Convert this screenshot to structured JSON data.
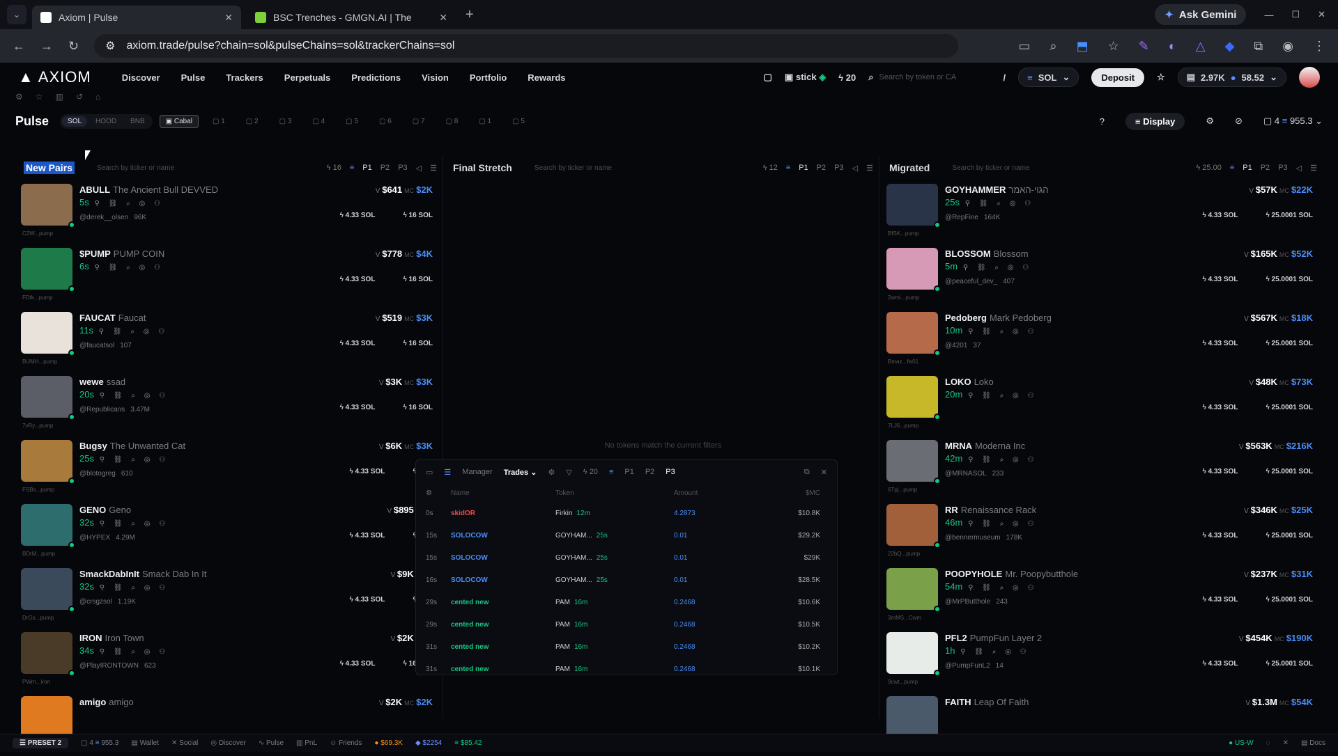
{
  "browser": {
    "tabs": [
      {
        "title": "Axiom | Pulse"
      },
      {
        "title": "BSC Trenches - GMGN.AI | The"
      }
    ],
    "ask_gemini": "Ask Gemini",
    "url": "axiom.trade/pulse?chain=sol&pulseChains=sol&trackerChains=sol"
  },
  "nav": {
    "logo": "AXIOM",
    "items": [
      "Discover",
      "Pulse",
      "Trackers",
      "Perpetuals",
      "Predictions",
      "Vision",
      "Portfolio",
      "Rewards"
    ],
    "wallet_label": "stick",
    "points": "20",
    "search_placeholder": "Search by token or CA",
    "search_key": "/",
    "chain": "SOL",
    "deposit": "Deposit",
    "balance1": "2.97K",
    "balance2": "58.52"
  },
  "pulse": {
    "title": "Pulse",
    "chains": [
      "SOL",
      "HOOD",
      "BNB"
    ],
    "cabal": "Cabal",
    "slots": [
      "1",
      "2",
      "3",
      "4",
      "5",
      "6",
      "7",
      "8",
      "1",
      "5"
    ],
    "display": "Display",
    "count": "4",
    "value": "955.3"
  },
  "columns": [
    {
      "name": "New Pairs",
      "search": "Search by ticker or name",
      "count": "16",
      "presets": [
        "P1",
        "P2",
        "P3"
      ],
      "rows": [
        {
          "sym": "ABULL",
          "name": "The Ancient Bull DEVVED",
          "age": "5s",
          "handle": "@derek__olsen",
          "followers": "96K",
          "caption": "C2W...pump",
          "v": "$641",
          "mc": "$2K",
          "buy1": "4.33 SOL",
          "buy2": "16 SOL",
          "thumb": "#8b6d4e"
        },
        {
          "sym": "$PUMP",
          "name": "PUMP COIN",
          "age": "6s",
          "handle": "",
          "followers": "",
          "caption": "FDtk...pump",
          "v": "$778",
          "mc": "$4K",
          "buy1": "4.33 SOL",
          "buy2": "16 SOL",
          "thumb": "#1f7a4a"
        },
        {
          "sym": "FAUCAT",
          "name": "Faucat",
          "age": "11s",
          "handle": "@faucatsol",
          "followers": "107",
          "caption": "BUMH...pump",
          "v": "$519",
          "mc": "$3K",
          "buy1": "4.33 SOL",
          "buy2": "16 SOL",
          "thumb": "#e8e2da"
        },
        {
          "sym": "wewe",
          "name": "ssad",
          "age": "20s",
          "handle": "@Republicans",
          "followers": "3.47M",
          "caption": "7vRy...pump",
          "v": "$3K",
          "mc": "$3K",
          "buy1": "4.33 SOL",
          "buy2": "16 SOL",
          "thumb": "#5b5e66"
        },
        {
          "sym": "Bugsy",
          "name": "The Unwanted Cat",
          "age": "25s",
          "handle": "@blotogreg",
          "followers": "610",
          "caption": "FSBs...pump",
          "v": "$6K",
          "mc": "$3K",
          "buy1": "4.33 SOL",
          "buy2": "16 S",
          "thumb": "#a87a3c"
        },
        {
          "sym": "GENO",
          "name": "Geno",
          "age": "32s",
          "handle": "@HYPEX",
          "followers": "4.29M",
          "caption": "BDrM...pump",
          "v": "$895",
          "mc": "$",
          "buy1": "4.33 SOL",
          "buy2": "16 S",
          "thumb": "#2d6d6d"
        },
        {
          "sym": "SmackDabInIt",
          "name": "Smack Dab In It",
          "age": "32s",
          "handle": "@crsgzsol",
          "followers": "1.19K",
          "caption": "DrGs...pump",
          "v": "$9K",
          "mc": "$",
          "buy1": "4.33 SOL",
          "buy2": "16 S",
          "thumb": "#3b4a5a"
        },
        {
          "sym": "IRON",
          "name": "Iron Town",
          "age": "34s",
          "handle": "@PlayIRONTOWN",
          "followers": "623",
          "caption": "PWrn...iron",
          "v": "$2K",
          "mc": "$",
          "buy1": "4.33 SOL",
          "buy2": "16 SOL",
          "thumb": "#4a3a28"
        },
        {
          "sym": "amigo",
          "name": "amigo",
          "age": "",
          "handle": "",
          "followers": "",
          "caption": "",
          "v": "$2K",
          "mc": "$2K",
          "buy1": "",
          "buy2": "",
          "thumb": "#e07a20"
        }
      ]
    },
    {
      "name": "Final Stretch",
      "search": "Search by ticker or name",
      "count": "12",
      "presets": [
        "P1",
        "P2",
        "P3"
      ],
      "empty": "No tokens match the current filters"
    },
    {
      "name": "Migrated",
      "search": "Search by ticker or name",
      "count": "25.00",
      "presets": [
        "P1",
        "P2",
        "P3"
      ],
      "rows": [
        {
          "sym": "GOYHAMMER",
          "name": "הגוי-האמר",
          "age": "25s",
          "handle": "@RepFine",
          "followers": "164K",
          "caption": "BfSK...pump",
          "v": "$57K",
          "mc": "$22K",
          "buy1": "4.33 SOL",
          "buy2": "25.0001 SOL",
          "thumb": "#2a3448"
        },
        {
          "sym": "BLOSSOM",
          "name": "Blossom",
          "age": "5m",
          "handle": "@peaceful_dev_",
          "followers": "407",
          "caption": "2wmi...pump",
          "v": "$165K",
          "mc": "$52K",
          "buy1": "4.33 SOL",
          "buy2": "25.0001 SOL",
          "thumb": "#d69ab6"
        },
        {
          "sym": "Pedoberg",
          "name": "Mark Pedoberg",
          "age": "10m",
          "handle": "@4201",
          "followers": "37",
          "caption": "Bmaz...fw01",
          "v": "$567K",
          "mc": "$18K",
          "buy1": "4.33 SOL",
          "buy2": "25.0001 SOL",
          "thumb": "#b56b4a"
        },
        {
          "sym": "LOKO",
          "name": "Loko",
          "age": "20m",
          "handle": "",
          "followers": "",
          "caption": "7LJ6...pump",
          "v": "$48K",
          "mc": "$73K",
          "buy1": "4.33 SOL",
          "buy2": "25.0001 SOL",
          "thumb": "#c7b82a"
        },
        {
          "sym": "MRNA",
          "name": "Moderna Inc",
          "age": "42m",
          "handle": "@MRNASOL",
          "followers": "233",
          "caption": "6Tpj...pump",
          "v": "$563K",
          "mc": "$216K",
          "buy1": "4.33 SOL",
          "buy2": "25.0001 SOL",
          "thumb": "#6a6e74"
        },
        {
          "sym": "RR",
          "name": "Renaissance Rack",
          "age": "46m",
          "handle": "@bennermuseum",
          "followers": "178K",
          "caption": "22bQ...pump",
          "v": "$346K",
          "mc": "$25K",
          "buy1": "4.33 SOL",
          "buy2": "25.0001 SOL",
          "thumb": "#a2603a"
        },
        {
          "sym": "POOPYHOLE",
          "name": "Mr. Poopybutthole",
          "age": "54m",
          "handle": "@MrPButthole",
          "followers": "243",
          "caption": "3mMS...Cwm",
          "v": "$237K",
          "mc": "$31K",
          "buy1": "4.33 SOL",
          "buy2": "25.0001 SOL",
          "thumb": "#7aa04a"
        },
        {
          "sym": "PFL2",
          "name": "PumpFun Layer 2",
          "age": "1h",
          "handle": "@PumpFunL2",
          "followers": "14",
          "caption": "9cwt...pump",
          "v": "$454K",
          "mc": "$190K",
          "buy1": "4.33 SOL",
          "buy2": "25.0001 SOL",
          "thumb": "#e8ece8"
        },
        {
          "sym": "FAITH",
          "name": "Leap Of Faith",
          "age": "",
          "handle": "",
          "followers": "",
          "caption": "",
          "v": "$1.3M",
          "mc": "$54K",
          "buy1": "",
          "buy2": "",
          "thumb": "#4a5a6a"
        }
      ]
    }
  ],
  "trades": {
    "manager": "Manager",
    "tab": "Trades",
    "count": "20",
    "presets": [
      "P1",
      "P2",
      "P3"
    ],
    "headers": [
      "Name",
      "Token",
      "Amount",
      "$MC"
    ],
    "rows": [
      {
        "t": "0s",
        "name": "skidOR",
        "color": "#e84c4c",
        "token": "Firkin",
        "tage": "12m",
        "amt": "4.2873",
        "mc": "$10.8K"
      },
      {
        "t": "15s",
        "name": "SOLOCOW",
        "color": "#4a8ef8",
        "token": "GOYHAM...",
        "tage": "25s",
        "amt": "0.01",
        "mc": "$29.2K"
      },
      {
        "t": "15s",
        "name": "SOLOCOW",
        "color": "#4a8ef8",
        "token": "GOYHAM...",
        "tage": "25s",
        "amt": "0.01",
        "mc": "$29K"
      },
      {
        "t": "16s",
        "name": "SOLOCOW",
        "color": "#4a8ef8",
        "token": "GOYHAM...",
        "tage": "25s",
        "amt": "0.01",
        "mc": "$28.5K"
      },
      {
        "t": "29s",
        "name": "cented new",
        "color": "#16c784",
        "token": "PAM",
        "tage": "16m",
        "amt": "0.2468",
        "mc": "$10.6K"
      },
      {
        "t": "29s",
        "name": "cented new",
        "color": "#16c784",
        "token": "PAM",
        "tage": "16m",
        "amt": "0.2468",
        "mc": "$10.5K"
      },
      {
        "t": "31s",
        "name": "cented new",
        "color": "#16c784",
        "token": "PAM",
        "tage": "16m",
        "amt": "0.2468",
        "mc": "$10.2K"
      },
      {
        "t": "31s",
        "name": "cented new",
        "color": "#16c784",
        "token": "PAM",
        "tage": "16m",
        "amt": "0.2468",
        "mc": "$10.1K"
      }
    ]
  },
  "footer": {
    "preset": "PRESET 2",
    "count": "4",
    "value": "955.3",
    "items": [
      "Wallet",
      "Social",
      "Discover",
      "Pulse",
      "PnL",
      "Friends"
    ],
    "btc": "$69.3K",
    "eth": "$2254",
    "sol": "$85.42",
    "region": "US-W",
    "docs": "Docs"
  }
}
